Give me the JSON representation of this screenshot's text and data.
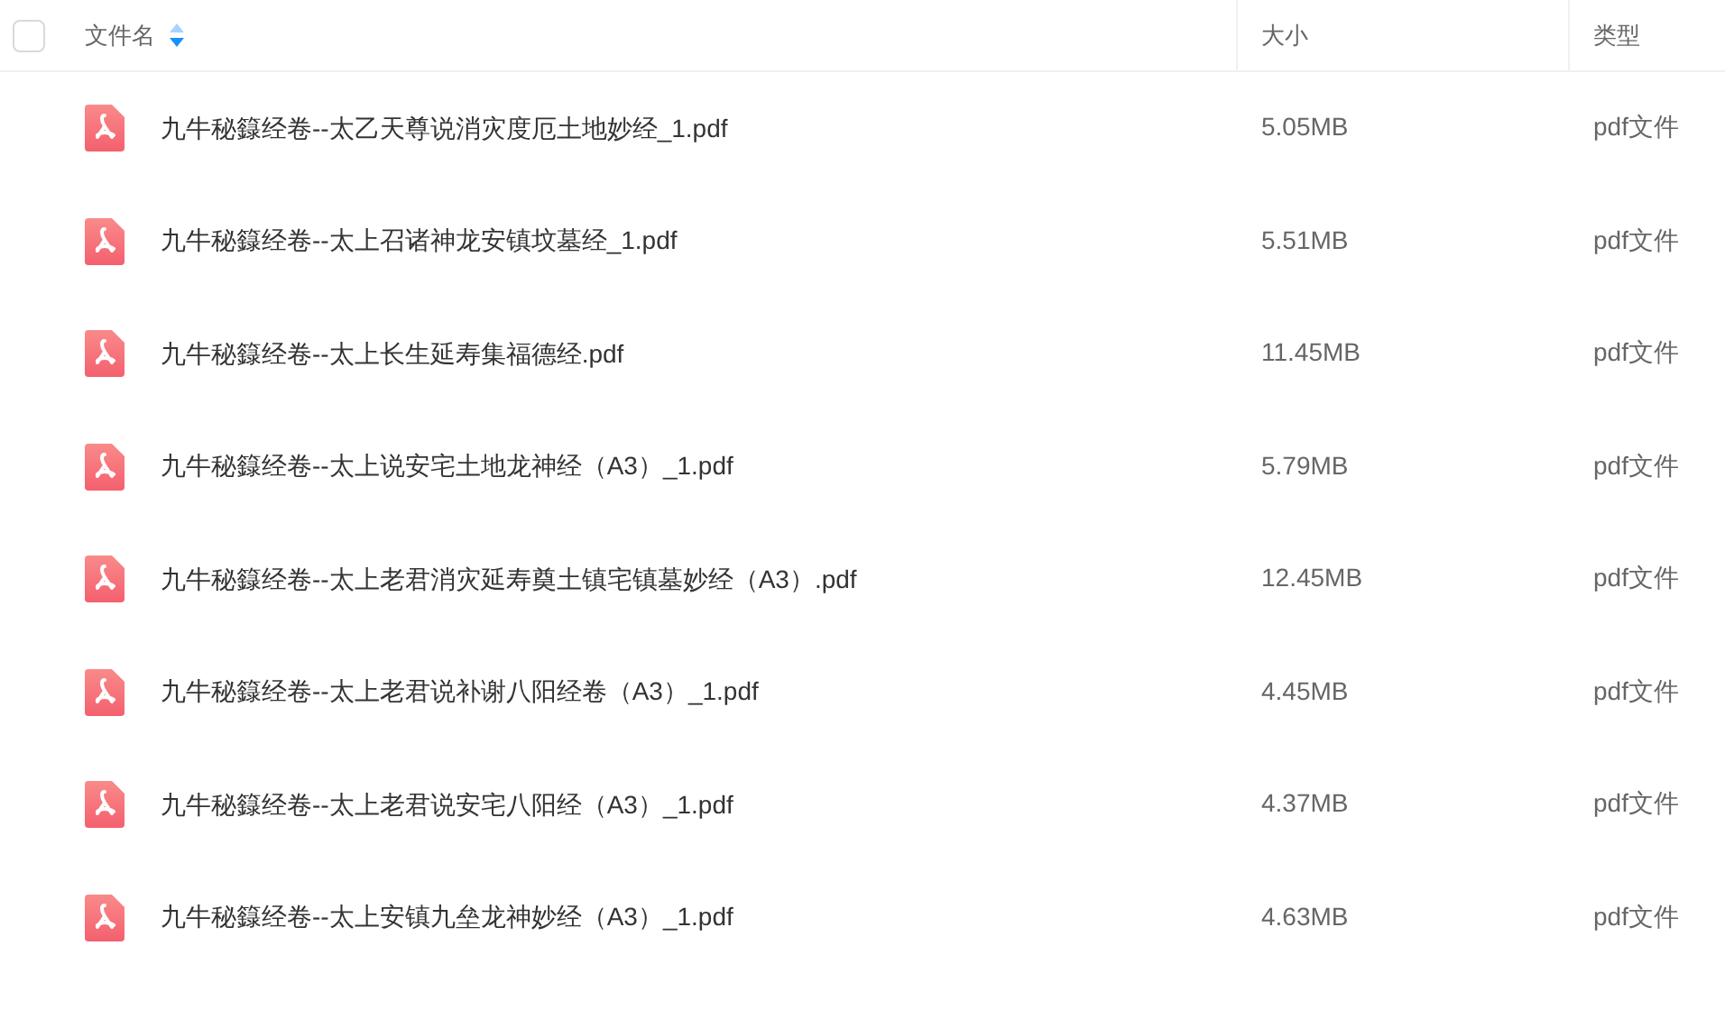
{
  "header": {
    "select_all": {
      "checked": false
    },
    "columns": [
      "文件名",
      "大小",
      "类型"
    ]
  },
  "rows": [
    {
      "name": "九牛秘籙经卷--太乙天尊说消灾度厄土地妙经_1.pdf",
      "size": "5.05MB",
      "type": "pdf文件"
    },
    {
      "name": "九牛秘籙经卷--太上召诸神龙安镇坟墓经_1.pdf",
      "size": "5.51MB",
      "type": "pdf文件"
    },
    {
      "name": "九牛秘籙经卷--太上长生延寿集福德经.pdf",
      "size": "11.45MB",
      "type": "pdf文件"
    },
    {
      "name": "九牛秘籙经卷--太上说安宅土地龙神经（A3）_1.pdf",
      "size": "5.79MB",
      "type": "pdf文件"
    },
    {
      "name": "九牛秘籙经卷--太上老君消灾延寿奠土镇宅镇墓妙经（A3）.pdf",
      "size": "12.45MB",
      "type": "pdf文件"
    },
    {
      "name": "九牛秘籙经卷--太上老君说补谢八阳经卷（A3）_1.pdf",
      "size": "4.45MB",
      "type": "pdf文件"
    },
    {
      "name": "九牛秘籙经卷--太上老君说安宅八阳经（A3）_1.pdf",
      "size": "4.37MB",
      "type": "pdf文件"
    },
    {
      "name": "九牛秘籙经卷--太上安镇九垒龙神妙经（A3）_1.pdf",
      "size": "4.63MB",
      "type": "pdf文件"
    }
  ]
}
